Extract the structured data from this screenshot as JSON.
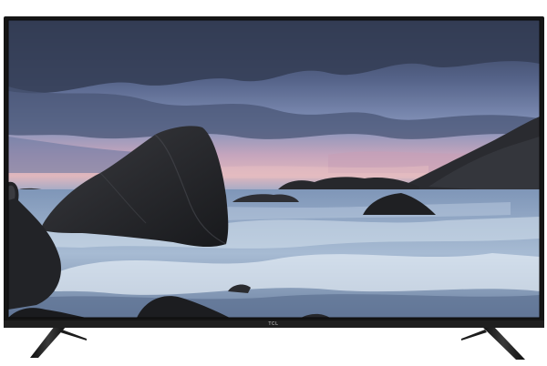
{
  "product": {
    "type": "flat-screen-television",
    "brand_logo_text": "TCL"
  },
  "screen": {
    "scene": "rocky-seashore-at-dusk"
  },
  "colors": {
    "bezel": "#151515",
    "sky_top": "#3c4760",
    "sky_mid": "#6f7fa5",
    "sunset_glow": "#d9a3b5",
    "sea": "#8fa7c4",
    "surf": "#dfe8f3",
    "rock": "#252629",
    "stand": "#1c1c1c",
    "background": "#ffffff"
  },
  "icons": [
    "tv-stand-left-icon",
    "tv-stand-right-icon"
  ]
}
